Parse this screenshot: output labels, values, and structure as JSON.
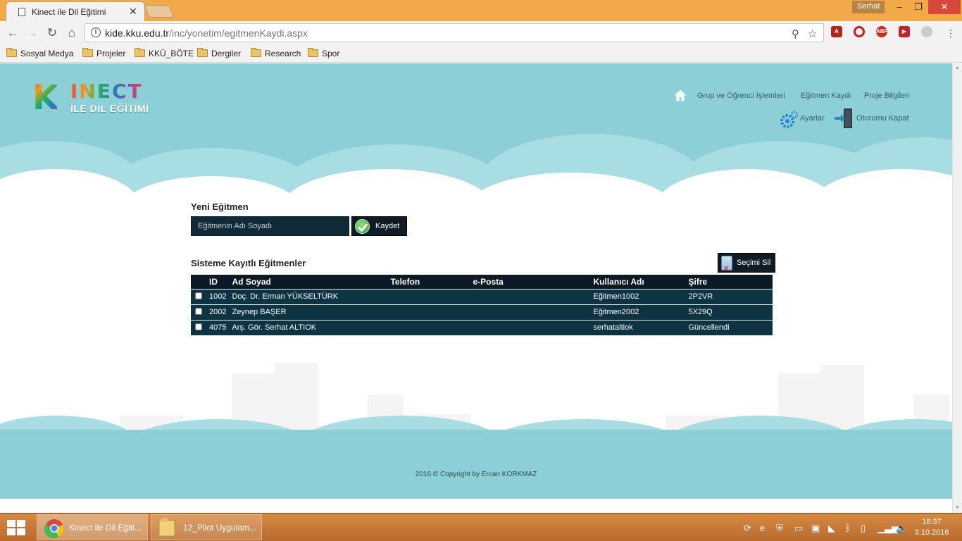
{
  "browser": {
    "tab_title": "Kinect ile Dil Eğitimi",
    "tab_close": "✕",
    "user_name": "Serhat",
    "window_min": "–",
    "window_max": "❐",
    "window_close": "✕",
    "url_host": "kide.kku.edu.tr",
    "url_path": "/inc/yonetim/egitmenKaydi.aspx",
    "bookmarks": [
      "Sosyal Medya",
      "Projeler",
      "KKÜ_BÖTE",
      "Dergiler",
      "Research",
      "Spor"
    ]
  },
  "site": {
    "logo_k": "K",
    "logo_word": "INECT",
    "logo_sub": "İLE DİL EĞİTİMİ",
    "nav": {
      "groups": "Grup ve Öğrenci İşlemleri",
      "instructor": "Eğitmen Kaydı",
      "project": "Proje Bilgileri",
      "settings": "Ayarlar",
      "logout": "Oturumu Kapat"
    }
  },
  "form": {
    "title": "Yeni Eğitmen",
    "name_placeholder": "Eğitmenin Adı Soyadı",
    "save_label": "Kaydet"
  },
  "list": {
    "title": "Sisteme Kayıtlı Eğitmenler",
    "delete_label": "Seçimi Sil",
    "columns": [
      "ID",
      "Ad Soyad",
      "Telefon",
      "e-Posta",
      "Kullanıcı Adı",
      "Şifre"
    ],
    "rows": [
      {
        "id": "1002",
        "name": "Doç. Dr. Erman YÜKSELTÜRK",
        "phone": "",
        "email": "",
        "username": "Eğitmen1002",
        "password": "2P2VR"
      },
      {
        "id": "2002",
        "name": "Zeynep BAŞER",
        "phone": "",
        "email": "",
        "username": "Eğitmen2002",
        "password": "5X29Q"
      },
      {
        "id": "4075",
        "name": "Arş. Gör. Serhat ALTIOK",
        "phone": "",
        "email": "",
        "username": "serhataltiok",
        "password": "Güncellendi"
      }
    ]
  },
  "footer": {
    "copyright": "2016 © Copyright by Ercan KORKMAZ"
  },
  "taskbar": {
    "tasks": [
      "Kinect ile Dil Eğiti...",
      "12_Pilot Uygulam..."
    ],
    "time": "18:37",
    "date": "3.10.2016"
  },
  "colors": {
    "header_bg": "#8ccfd7",
    "table_bg": "#0e3343",
    "table_head": "#0b1a24",
    "titlebar": "#f2a94a",
    "taskbar": "#c77a38"
  }
}
